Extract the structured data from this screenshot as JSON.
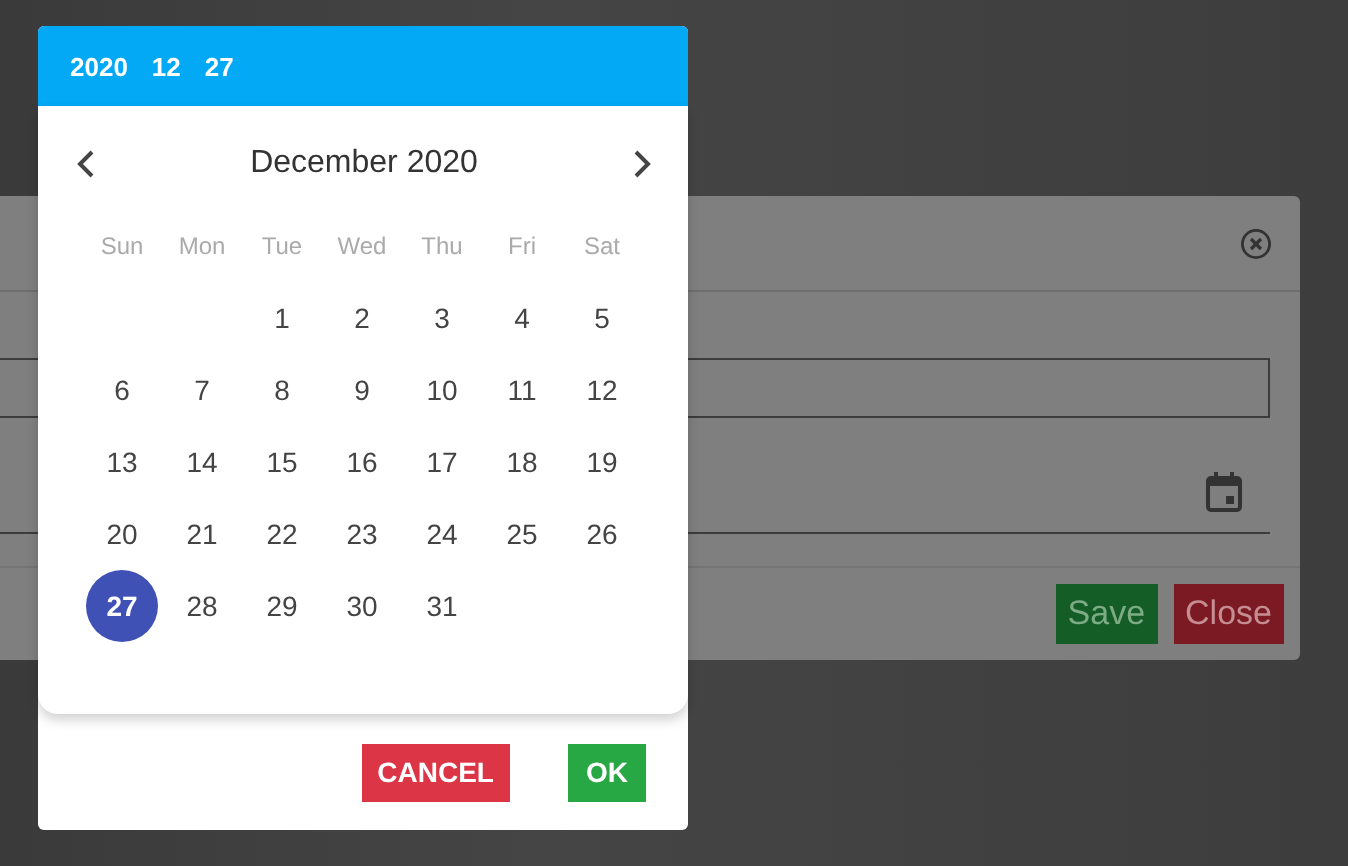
{
  "background_dialog": {
    "buttons": [
      {
        "label": "Save",
        "kind": "save"
      },
      {
        "label": "Close",
        "kind": "close"
      }
    ]
  },
  "date_picker": {
    "header": {
      "year": "2020",
      "month": "12",
      "day": "27"
    },
    "title": "December 2020",
    "weekdays": [
      "Sun",
      "Mon",
      "Tue",
      "Wed",
      "Thu",
      "Fri",
      "Sat"
    ],
    "weeks": [
      {
        "kind": "first",
        "days": [
          {
            "label": "1",
            "selected": false
          },
          {
            "label": "2",
            "selected": false
          },
          {
            "label": "3",
            "selected": false
          },
          {
            "label": "4",
            "selected": false
          },
          {
            "label": "5",
            "selected": false
          }
        ]
      },
      {
        "kind": "full",
        "days": [
          {
            "label": "6",
            "selected": false
          },
          {
            "label": "7",
            "selected": false
          },
          {
            "label": "8",
            "selected": false
          },
          {
            "label": "9",
            "selected": false
          },
          {
            "label": "10",
            "selected": false
          },
          {
            "label": "11",
            "selected": false
          },
          {
            "label": "12",
            "selected": false
          }
        ]
      },
      {
        "kind": "full",
        "days": [
          {
            "label": "13",
            "selected": false
          },
          {
            "label": "14",
            "selected": false
          },
          {
            "label": "15",
            "selected": false
          },
          {
            "label": "16",
            "selected": false
          },
          {
            "label": "17",
            "selected": false
          },
          {
            "label": "18",
            "selected": false
          },
          {
            "label": "19",
            "selected": false
          }
        ]
      },
      {
        "kind": "full",
        "days": [
          {
            "label": "20",
            "selected": false
          },
          {
            "label": "21",
            "selected": false
          },
          {
            "label": "22",
            "selected": false
          },
          {
            "label": "23",
            "selected": false
          },
          {
            "label": "24",
            "selected": false
          },
          {
            "label": "25",
            "selected": false
          },
          {
            "label": "26",
            "selected": false
          }
        ]
      },
      {
        "kind": "last",
        "days": [
          {
            "label": "27",
            "selected": true
          },
          {
            "label": "28",
            "selected": false
          },
          {
            "label": "29",
            "selected": false
          },
          {
            "label": "30",
            "selected": false
          },
          {
            "label": "31",
            "selected": false
          }
        ]
      }
    ],
    "buttons": [
      {
        "label": "CANCEL",
        "kind": "cancel"
      },
      {
        "label": "OK",
        "kind": "ok"
      }
    ]
  }
}
